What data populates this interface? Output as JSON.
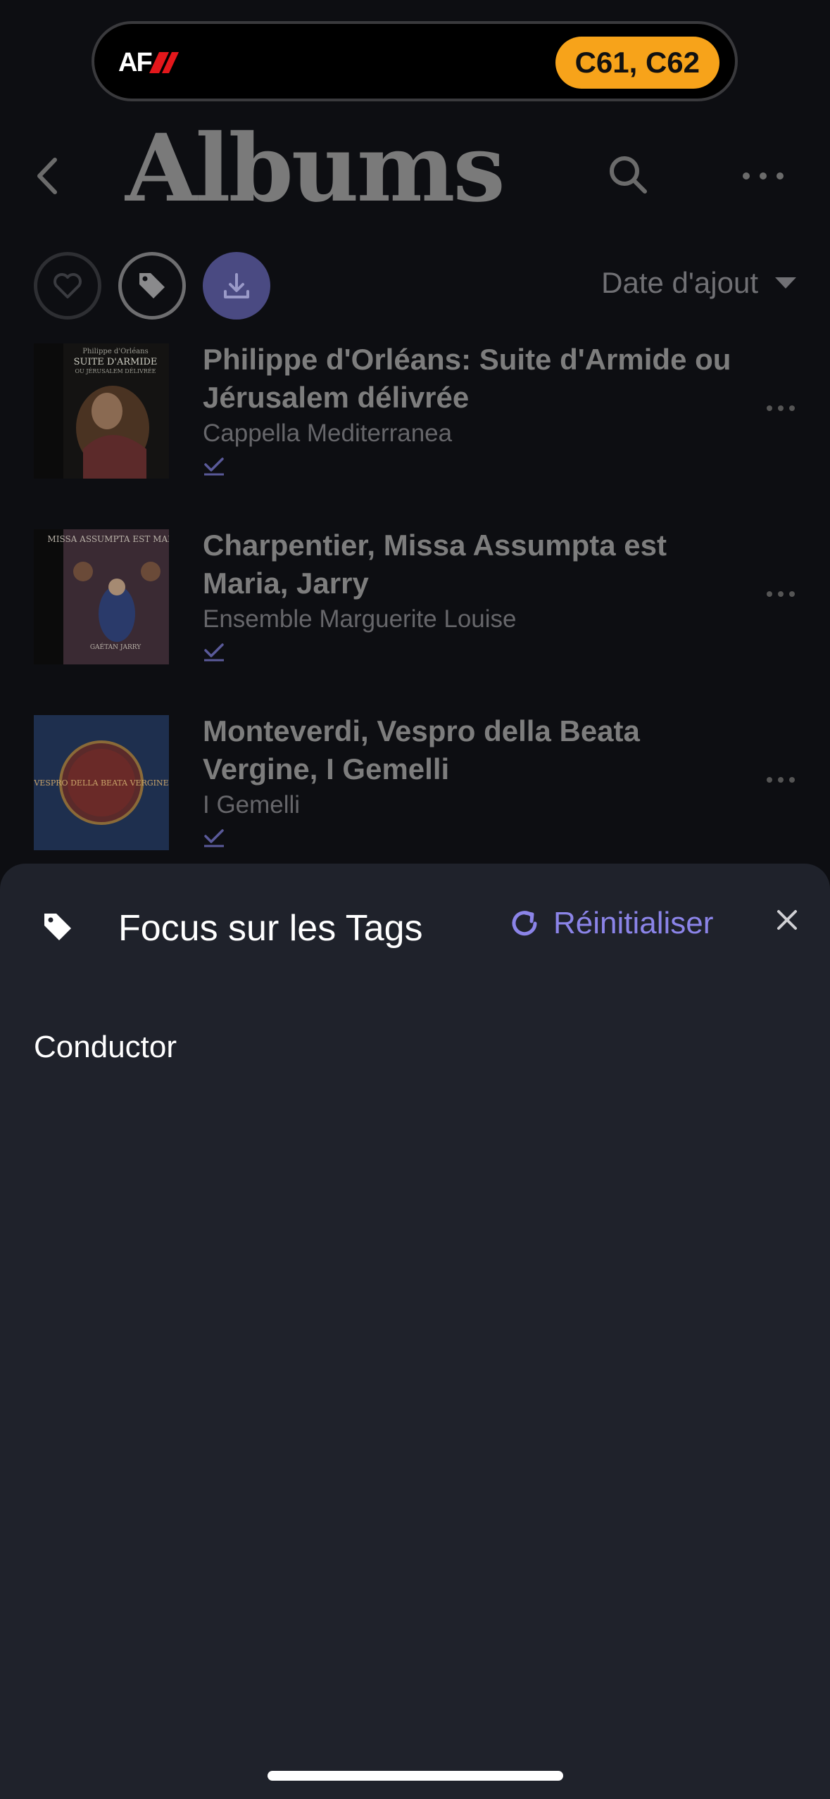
{
  "status": {
    "airline_logo": "AF",
    "gate_text": "C61, C62",
    "accent": "#f7a31a"
  },
  "header": {
    "title": "Albums",
    "back_icon": "chevron-left-icon",
    "search_icon": "search-icon",
    "more_icon": "ellipsis-icon"
  },
  "filters": {
    "favorites_icon": "heart-icon",
    "tags_icon": "tag-icon",
    "downloaded_icon": "download-icon",
    "sort_label": "Date d'ajout"
  },
  "albums": [
    {
      "title": "Philippe d'Orléans: Suite d'Armide ou Jérusalem délivrée",
      "artist": "Cappella Mediterranea",
      "cover_text_top": "Philippe d'Orléans",
      "cover_text_main": "SUITE D'ARMIDE",
      "cover_text_sub": "OU JÉRUSALEM DÉLIVRÉE"
    },
    {
      "title": "Charpentier, Missa Assumpta est Maria, Jarry",
      "artist": "Ensemble Marguerite Louise",
      "cover_text_main": "MISSA ASSUMPTA EST MARIA",
      "cover_text_sub": "GAÉTAN JARRY"
    },
    {
      "title": "Monteverdi, Vespro della Beata Vergine, I Gemelli",
      "artist": "I Gemelli",
      "cover_text_main": "VESPRO DELLA BEATA VERGINE"
    }
  ],
  "sheet": {
    "title": "Focus sur les Tags",
    "reset_label": "Réinitialiser",
    "section_label": "Conductor",
    "accent": "#8b84e8"
  }
}
